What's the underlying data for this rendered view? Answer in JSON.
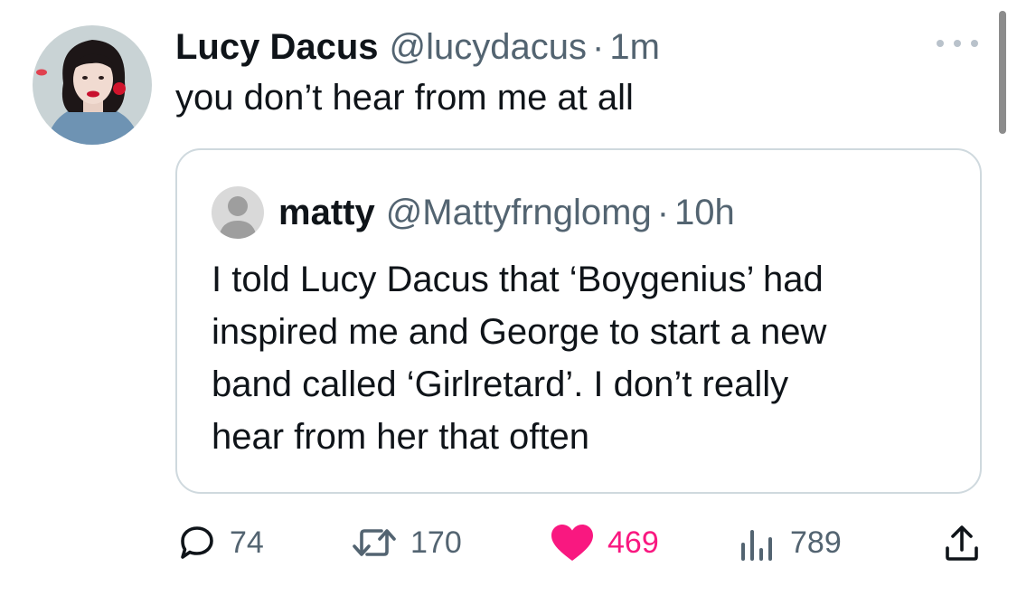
{
  "tweet": {
    "author": {
      "name": "Lucy Dacus",
      "handle": "@lucydacus",
      "separator": "·",
      "time": "1m"
    },
    "text": "you don’t hear from me at all"
  },
  "quoted": {
    "author": {
      "name": "matty",
      "handle": "@Mattyfrnglomg",
      "separator": "·",
      "time": "10h"
    },
    "lines": [
      "I told Lucy Dacus that ‘Boygenius’ had",
      "inspired me and George to start a new",
      "band called ‘Girlretard’. I don’t really",
      "hear from her that often"
    ]
  },
  "actions": {
    "replies": "74",
    "retweets": "170",
    "likes": "469",
    "views": "789"
  },
  "icons": {
    "more": "more-horizontal-icon",
    "reply": "reply-icon",
    "retweet": "retweet-icon",
    "like": "heart-filled-icon",
    "views": "views-chart-icon",
    "share": "share-icon"
  },
  "colors": {
    "text": "#0f1419",
    "secondary": "#536471",
    "border": "#cfd9de",
    "like": "#f91880"
  }
}
